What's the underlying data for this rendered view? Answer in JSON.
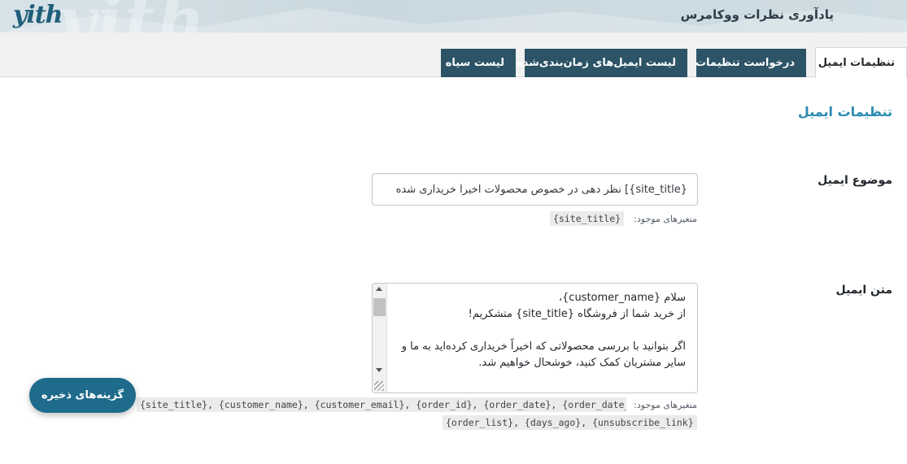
{
  "header": {
    "logo_text": "yith",
    "plugin_title": "یادآوری نظرات ووکامرس",
    "watermark": "yith"
  },
  "tabs": [
    {
      "label": "تنظیمات ایمیل",
      "active": true
    },
    {
      "label": "درخواست تنظیمات",
      "active": false
    },
    {
      "label": "لیست ایمیل‌های زمان‌بندی‌شده",
      "active": false
    },
    {
      "label": "لیست سیاه",
      "active": false
    }
  ],
  "section": {
    "heading": "تنظیمات ایمیل"
  },
  "subject": {
    "label": "موضوع ایمیل",
    "value": "{site_title}] نظر دهی در خصوص محصولات اخیراً خریداری شده",
    "vars_label": "متغیرهای موجود:",
    "vars": "{site_title}"
  },
  "body": {
    "label": "متن ایمیل",
    "lines": [
      "سلام {customer_name}،",
      "از خرید شما از فروشگاه {site_title} متشکریم!",
      "",
      "اگر بتوانید با بررسی محصولاتی که اخیراً خریداری کرده‌اید به ما و سایر مشتریان کمک کنید، خوشحال خواهیم شد."
    ],
    "vars_label": "متغیرهای موجود:",
    "vars_line1": "{site_title}, {customer_name}, {customer_email}, {order_id}, {order_date}, {order_date_completed},",
    "vars_line2": "{order_list}, {days_ago}, {unsubscribe_link}"
  },
  "save_button": {
    "label": "گزینه‌های ذخیره"
  },
  "colors": {
    "accent": "#2a8ab0",
    "tab_bg": "#2c5466",
    "button_bg": "#1e6b8c"
  }
}
